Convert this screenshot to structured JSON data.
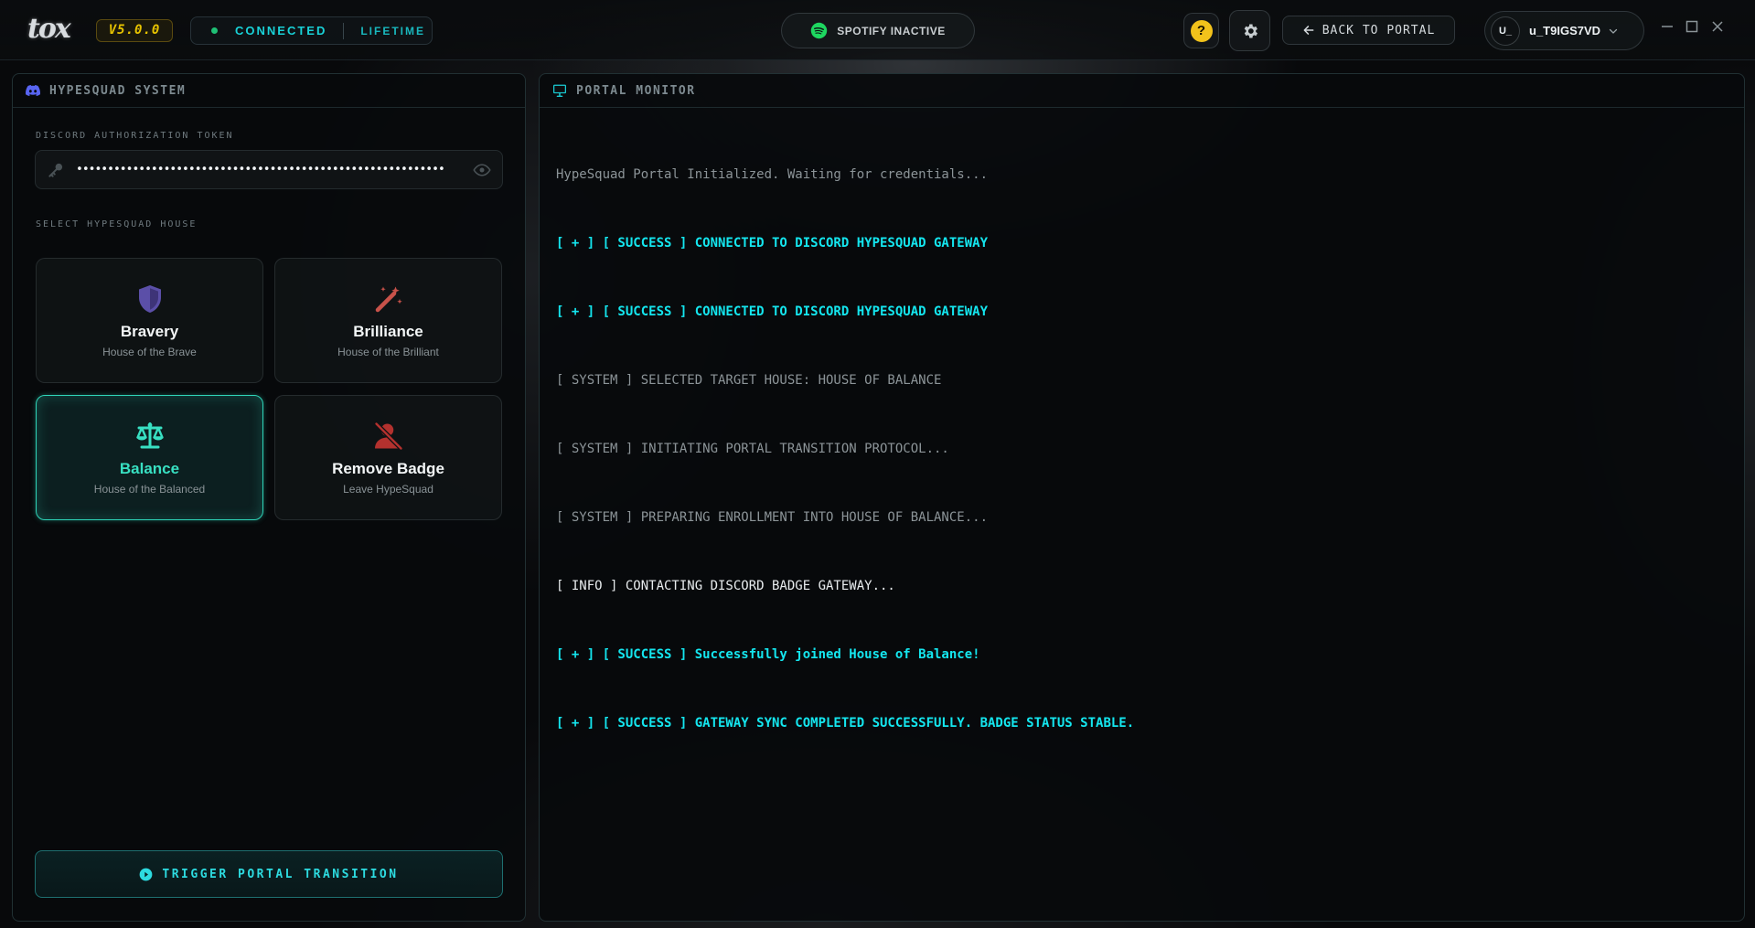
{
  "app": {
    "logo_text": "tox",
    "version": "V5.0.0",
    "status": "CONNECTED",
    "license": "LIFETIME",
    "spotify_status": "SPOTIFY INACTIVE",
    "help_label": "?",
    "back_label": "BACK TO PORTAL",
    "user": {
      "avatar_text": "U_",
      "username": "u_T9IGS7VD"
    }
  },
  "left_panel": {
    "title": "HYPESQUAD SYSTEM",
    "token_label": "DISCORD AUTHORIZATION TOKEN",
    "token_value": "•••••••••••••••••••••••••••••••••••••••••••••••••••••••••••",
    "house_label": "SELECT HYPESQUAD HOUSE",
    "houses": [
      {
        "name": "Bravery",
        "subtitle": "House of the Brave",
        "icon": "shield-icon",
        "color": "#5b4fa8",
        "selected": false
      },
      {
        "name": "Brilliance",
        "subtitle": "House of the Brilliant",
        "icon": "magic-wand-icon",
        "color": "#c8524a",
        "selected": false
      },
      {
        "name": "Balance",
        "subtitle": "House of the Balanced",
        "icon": "scales-icon",
        "color": "#38e0c2",
        "selected": true
      },
      {
        "name": "Remove Badge",
        "subtitle": "Leave HypeSquad",
        "icon": "user-remove-icon",
        "color": "#b3312e",
        "selected": false
      }
    ],
    "trigger_label": "TRIGGER PORTAL TRANSITION"
  },
  "right_panel": {
    "title": "PORTAL MONITOR",
    "log": [
      {
        "type": "gray",
        "text": "HypeSquad Portal Initialized. Waiting for credentials..."
      },
      {
        "type": "success",
        "text": "[ + ] [ SUCCESS ] CONNECTED TO DISCORD HYPESQUAD GATEWAY"
      },
      {
        "type": "success",
        "text": "[ + ] [ SUCCESS ] CONNECTED TO DISCORD HYPESQUAD GATEWAY"
      },
      {
        "type": "gray",
        "text": "[ SYSTEM ] SELECTED TARGET HOUSE: HOUSE OF BALANCE"
      },
      {
        "type": "gray",
        "text": "[ SYSTEM ] INITIATING PORTAL TRANSITION PROTOCOL..."
      },
      {
        "type": "gray",
        "text": "[ SYSTEM ] PREPARING ENROLLMENT INTO HOUSE OF BALANCE..."
      },
      {
        "type": "info",
        "text": "[ INFO ] CONTACTING DISCORD BADGE GATEWAY..."
      },
      {
        "type": "success",
        "text": "[ + ] [ SUCCESS ] Successfully joined House of Balance!"
      },
      {
        "type": "success",
        "text": "[ + ] [ SUCCESS ] GATEWAY SYNC COMPLETED SUCCESSFULLY. BADGE STATUS STABLE."
      }
    ]
  },
  "colors": {
    "accent": "#19d2d8",
    "balance": "#38e0c2",
    "version": "#e6c200",
    "connected_dot": "#1fbf75"
  }
}
